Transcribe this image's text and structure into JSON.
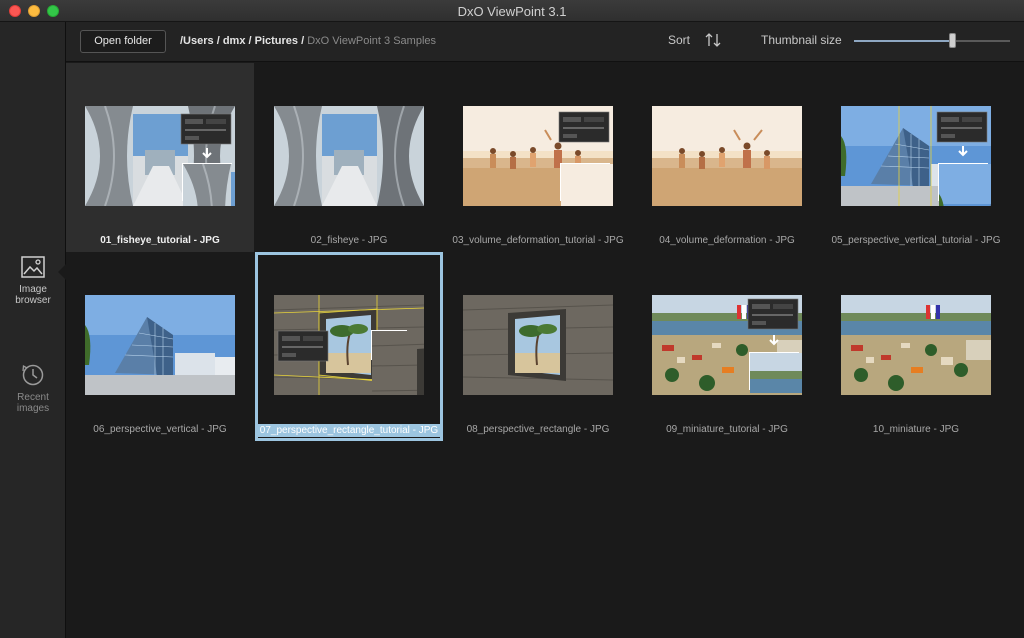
{
  "window": {
    "title": "DxO ViewPoint 3.1"
  },
  "sidebar": {
    "items": [
      {
        "label_line1": "Image",
        "label_line2": "browser",
        "icon": "image-icon"
      },
      {
        "label_line1": "Recent",
        "label_line2": "images",
        "icon": "clock-icon"
      }
    ]
  },
  "toolbar": {
    "open_folder_label": "Open folder",
    "breadcrumb": {
      "users": "/Users",
      "user": "dmx",
      "pictures": "Pictures",
      "current": "DxO ViewPoint 3 Samples",
      "sep": " / "
    },
    "sort_label": "Sort",
    "thumbnail_size_label": "Thumbnail size",
    "thumbnail_size_value": 0.63
  },
  "images": [
    {
      "name": "01_fisheye_tutorial - JPG",
      "kind": "fisheye-tutorial"
    },
    {
      "name": "02_fisheye - JPG",
      "kind": "fisheye"
    },
    {
      "name": "03_volume_deformation_tutorial - JPG",
      "kind": "beach-tutorial"
    },
    {
      "name": "04_volume_deformation - JPG",
      "kind": "beach"
    },
    {
      "name": "05_perspective_vertical_tutorial - JPG",
      "kind": "building-tutorial"
    },
    {
      "name": "06_perspective_vertical - JPG",
      "kind": "building"
    },
    {
      "name": "07_perspective_rectangle_tutorial - JPG",
      "kind": "window-tutorial"
    },
    {
      "name": "08_perspective_rectangle - JPG",
      "kind": "window"
    },
    {
      "name": "09_miniature_tutorial - JPG",
      "kind": "fair-tutorial"
    },
    {
      "name": "10_miniature - JPG",
      "kind": "fair"
    }
  ],
  "state": {
    "hovered_index": 0,
    "selected_index": 6
  }
}
